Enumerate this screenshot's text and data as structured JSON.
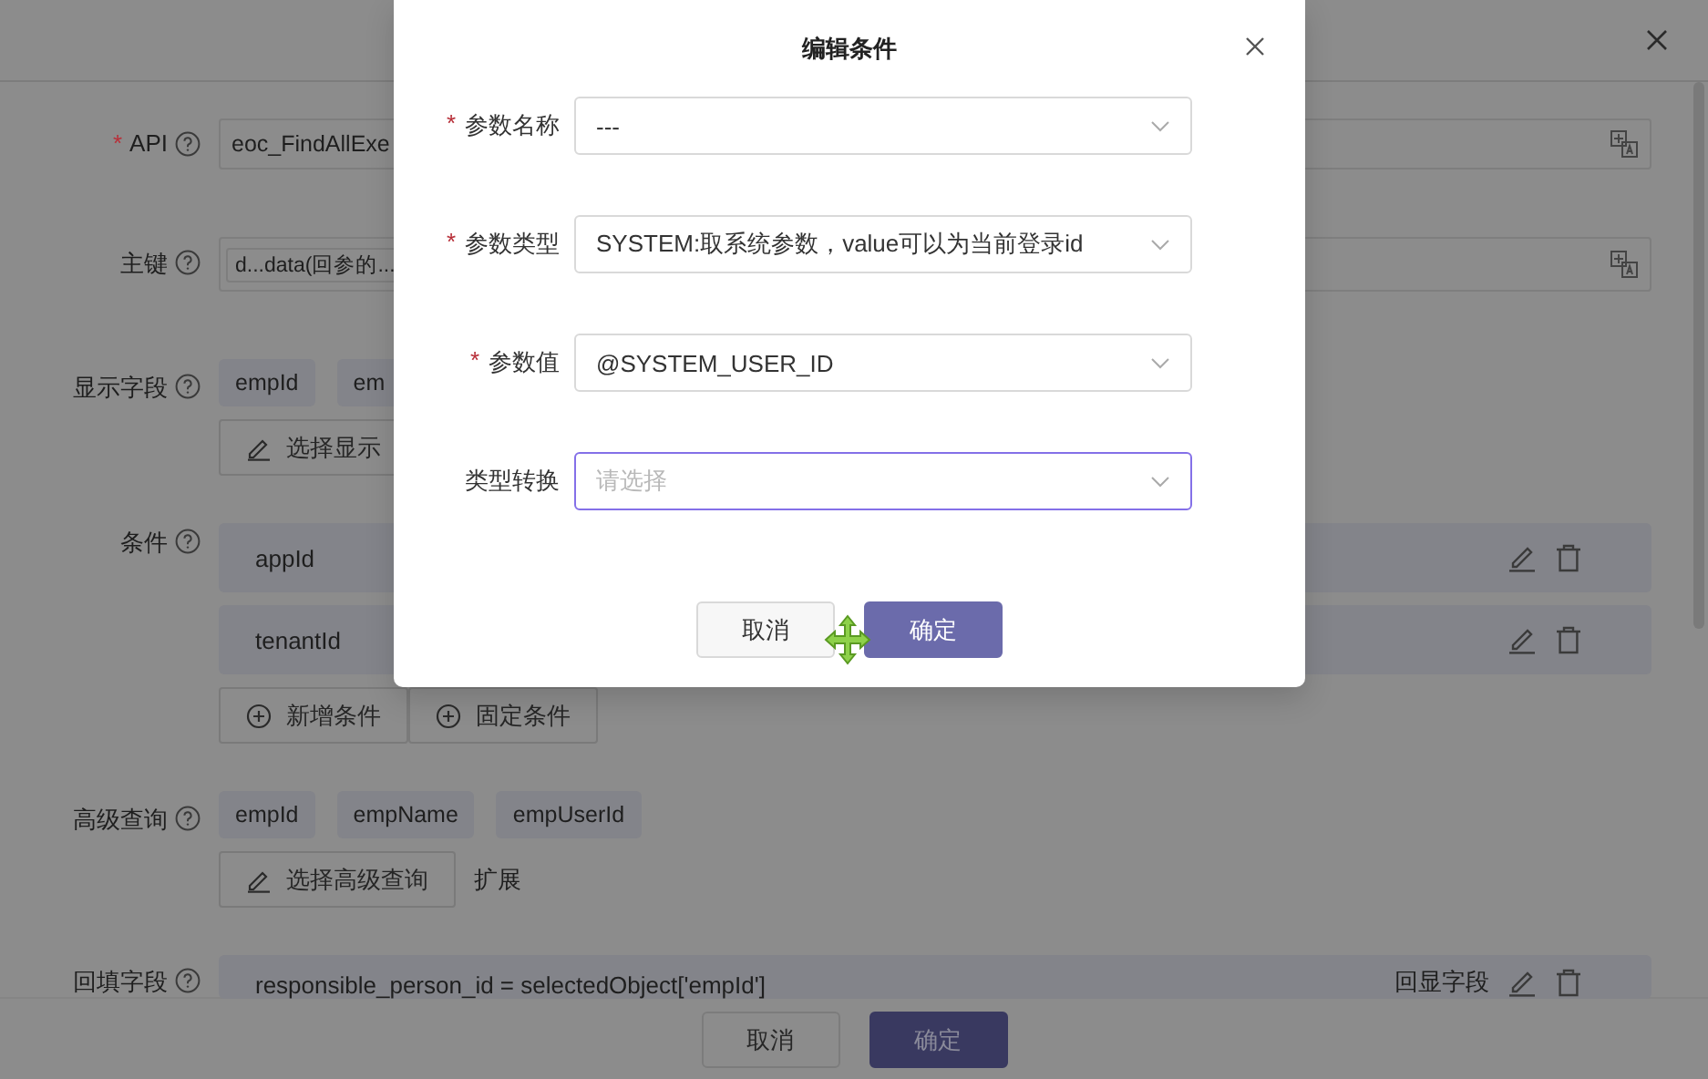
{
  "background_form": {
    "rows": [
      {
        "required_mark": "*",
        "label": "API",
        "kind": "input",
        "value": "eoc_FindAllExe"
      },
      {
        "label": "主键",
        "kind": "tag_input",
        "value": "d...data(回参的..."
      },
      {
        "label": "显示字段",
        "kind": "tags",
        "tags": [
          "empId",
          "em"
        ],
        "actions": [
          "选择显示"
        ]
      },
      {
        "label": "条件",
        "kind": "conditions",
        "items": [
          "appId",
          "tenantId"
        ],
        "actions": [
          "新增条件",
          "固定条件"
        ]
      },
      {
        "label": "高级查询",
        "kind": "tags",
        "tags": [
          "empId",
          "empName",
          "empUserId"
        ],
        "actions": [
          "选择高级查询"
        ],
        "extra": "扩展"
      },
      {
        "label": "回填字段",
        "kind": "mapping",
        "value": "responsible_person_id = selectedObject['empId']",
        "side_label": "回显字段"
      }
    ]
  },
  "footer_buttons": [
    {
      "label": "取消",
      "primary": false
    },
    {
      "label": "确定",
      "primary": true
    }
  ],
  "dialog": {
    "title": "编辑条件",
    "fields": [
      {
        "required_mark": "*",
        "label": "参数名称",
        "value": "---",
        "focused": false
      },
      {
        "required_mark": "*",
        "label": "参数类型",
        "value": "SYSTEM:取系统参数，value可以为当前登录id",
        "focused": false
      },
      {
        "required_mark": "*",
        "label": "参数值",
        "value": "@SYSTEM_USER_ID",
        "focused": false
      },
      {
        "label": "类型转换",
        "placeholder": "请选择",
        "focused": true
      }
    ],
    "buttons": [
      {
        "label": "取消",
        "primary": false
      },
      {
        "label": "确定",
        "primary": true
      }
    ]
  }
}
